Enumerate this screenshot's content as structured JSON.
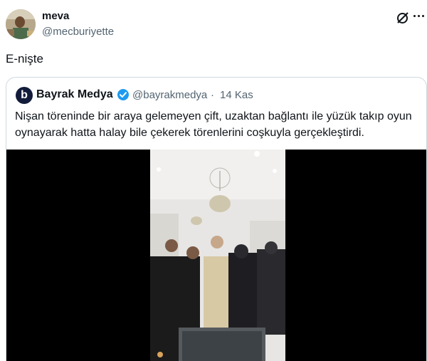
{
  "author": {
    "name": "meva",
    "handle": "@mecburiyette"
  },
  "tweet": {
    "text": "E-nişte"
  },
  "quote": {
    "logo_letter": "b",
    "name": "Bayrak Medya",
    "handle": "@bayrakmedya",
    "separator": "·",
    "date": "14 Kas",
    "text": "Nişan töreninde bir araya gelemeyen çift, uzaktan bağlantı ile yüzük takıp oyun oynayarak hatta halay bile çekerek törenlerini coşkuyla gerçekleştirdi."
  },
  "icons": {
    "x_logo": "x-logo-icon",
    "more": "more-options-icon",
    "verified": "verified-badge-icon"
  },
  "colors": {
    "text": "#0f1419",
    "secondary": "#536471",
    "border": "#cfd9de",
    "verified_blue": "#1d9bf0",
    "logo_navy": "#121c3a"
  }
}
